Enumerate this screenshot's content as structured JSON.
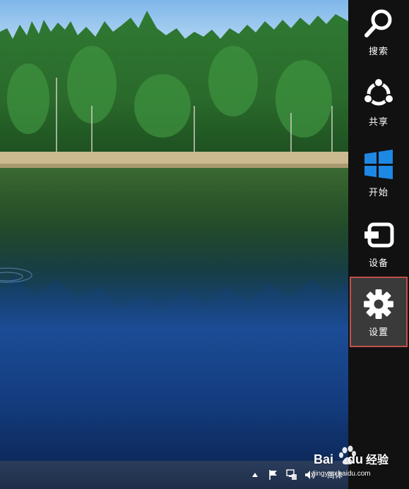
{
  "charms": {
    "search": {
      "label": "搜索",
      "icon": "search-icon"
    },
    "share": {
      "label": "共享",
      "icon": "share-icon"
    },
    "start": {
      "label": "开始",
      "icon": "windows-logo-icon"
    },
    "devices": {
      "label": "设备",
      "icon": "devices-icon"
    },
    "settings": {
      "label": "设置",
      "icon": "gear-icon",
      "highlighted": true,
      "highlight_color": "#c0504d"
    }
  },
  "taskbar": {
    "tray_icons": [
      "chevron-up-icon",
      "flag-icon",
      "network-icon",
      "volume-icon"
    ],
    "language": "简体"
  },
  "watermark": {
    "brand": "Bai",
    "brand2": "du",
    "service": "经验",
    "url": "jingyan.baidu.com"
  },
  "colors": {
    "charms_bg": "#111111",
    "highlight_border": "#c0504d",
    "start_tile": "#1e88e5"
  }
}
